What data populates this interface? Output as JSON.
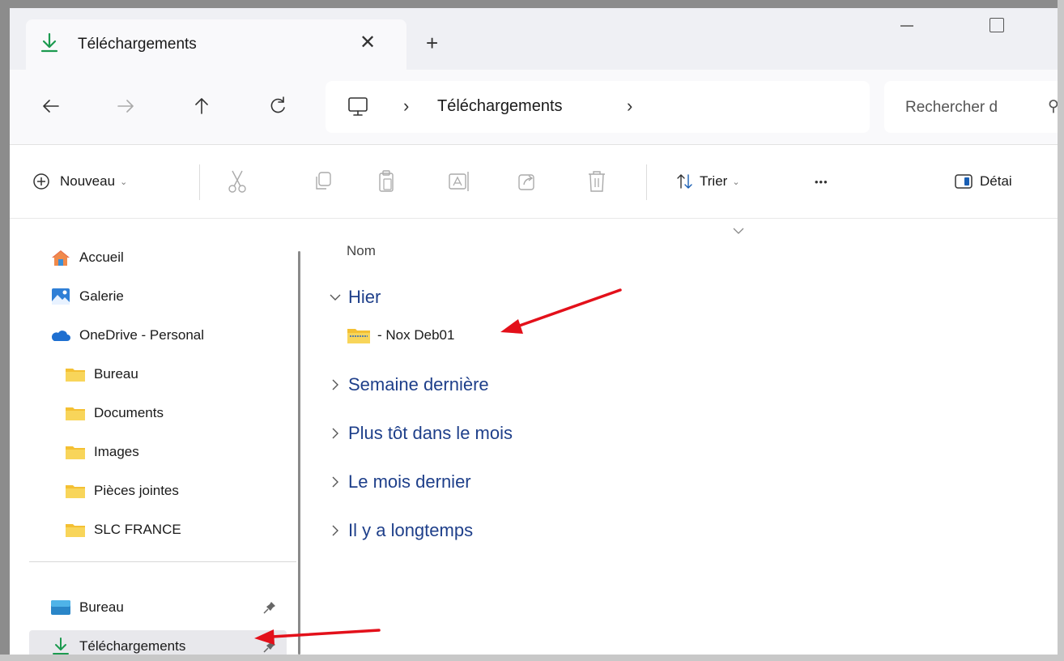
{
  "window": {
    "tab_title": "Téléchargements",
    "close_tab_glyph": "✕",
    "new_tab_glyph": "+"
  },
  "address": {
    "location": "Téléchargements",
    "separator": "›",
    "search_placeholder": "Rechercher d",
    "search_icon_glyph": "⚲"
  },
  "commands": {
    "new_label": "Nouveau",
    "sort_label": "Trier",
    "more_glyph": "•••",
    "details_label": "Détai",
    "chevron": "⌄"
  },
  "sidebar": {
    "items": [
      {
        "label": "Accueil",
        "icon": "home-icon"
      },
      {
        "label": "Galerie",
        "icon": "gallery-icon"
      },
      {
        "label": "OneDrive - Personal",
        "icon": "cloud-icon"
      },
      {
        "label": "Bureau",
        "icon": "folder-icon"
      },
      {
        "label": "Documents",
        "icon": "folder-icon"
      },
      {
        "label": "Images",
        "icon": "folder-icon"
      },
      {
        "label": "Pièces jointes",
        "icon": "folder-icon"
      },
      {
        "label": "SLC FRANCE",
        "icon": "folder-icon"
      }
    ],
    "pinned": [
      {
        "label": "Bureau",
        "icon": "desktop-icon"
      },
      {
        "label": "Téléchargements",
        "icon": "download-icon",
        "selected": true
      }
    ]
  },
  "main": {
    "column_name": "Nom",
    "groups": [
      {
        "label": "Hier",
        "expanded": true
      },
      {
        "label": "Semaine dernière",
        "expanded": false
      },
      {
        "label": "Plus tôt dans le mois",
        "expanded": false
      },
      {
        "label": "Le mois dernier",
        "expanded": false
      },
      {
        "label": "Il y a longtemps",
        "expanded": false
      }
    ],
    "files": [
      {
        "label": "- Nox Deb01",
        "icon": "zip-folder-icon"
      }
    ]
  },
  "colors": {
    "accent_green": "#1c9a4f",
    "group_blue": "#1e3f8a",
    "annotation_red": "#e3101a",
    "folder_yellow": "#f4c033"
  }
}
